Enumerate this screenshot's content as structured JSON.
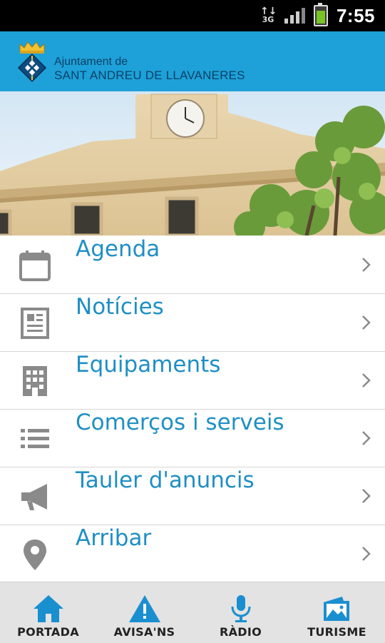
{
  "status_bar": {
    "network_top": "↑↓",
    "network_type": "3G",
    "time": "7:55"
  },
  "header": {
    "org_line1": "Ajuntament de",
    "org_line2": "SANT ANDREU DE LLAVANERES"
  },
  "menu": [
    {
      "label": "Agenda",
      "icon": "calendar-icon"
    },
    {
      "label": "Notícies",
      "icon": "newspaper-icon"
    },
    {
      "label": "Equipaments",
      "icon": "building-icon"
    },
    {
      "label": "Comerços i serveis",
      "icon": "list-icon"
    },
    {
      "label": "Tauler d'anuncis",
      "icon": "megaphone-icon"
    },
    {
      "label": "Arribar",
      "icon": "map-pin-icon"
    }
  ],
  "bottom_nav": [
    {
      "label": "PORTADA",
      "icon": "home-icon"
    },
    {
      "label": "AVISA'NS",
      "icon": "warning-icon"
    },
    {
      "label": "RÀDIO",
      "icon": "microphone-icon"
    },
    {
      "label": "TURISME",
      "icon": "tourism-icon"
    }
  ],
  "colors": {
    "header_bg": "#1da1d8",
    "accent": "#1f8fc4",
    "icon_gray": "#8a8a8a",
    "nav_icon": "#1a8fd0"
  }
}
